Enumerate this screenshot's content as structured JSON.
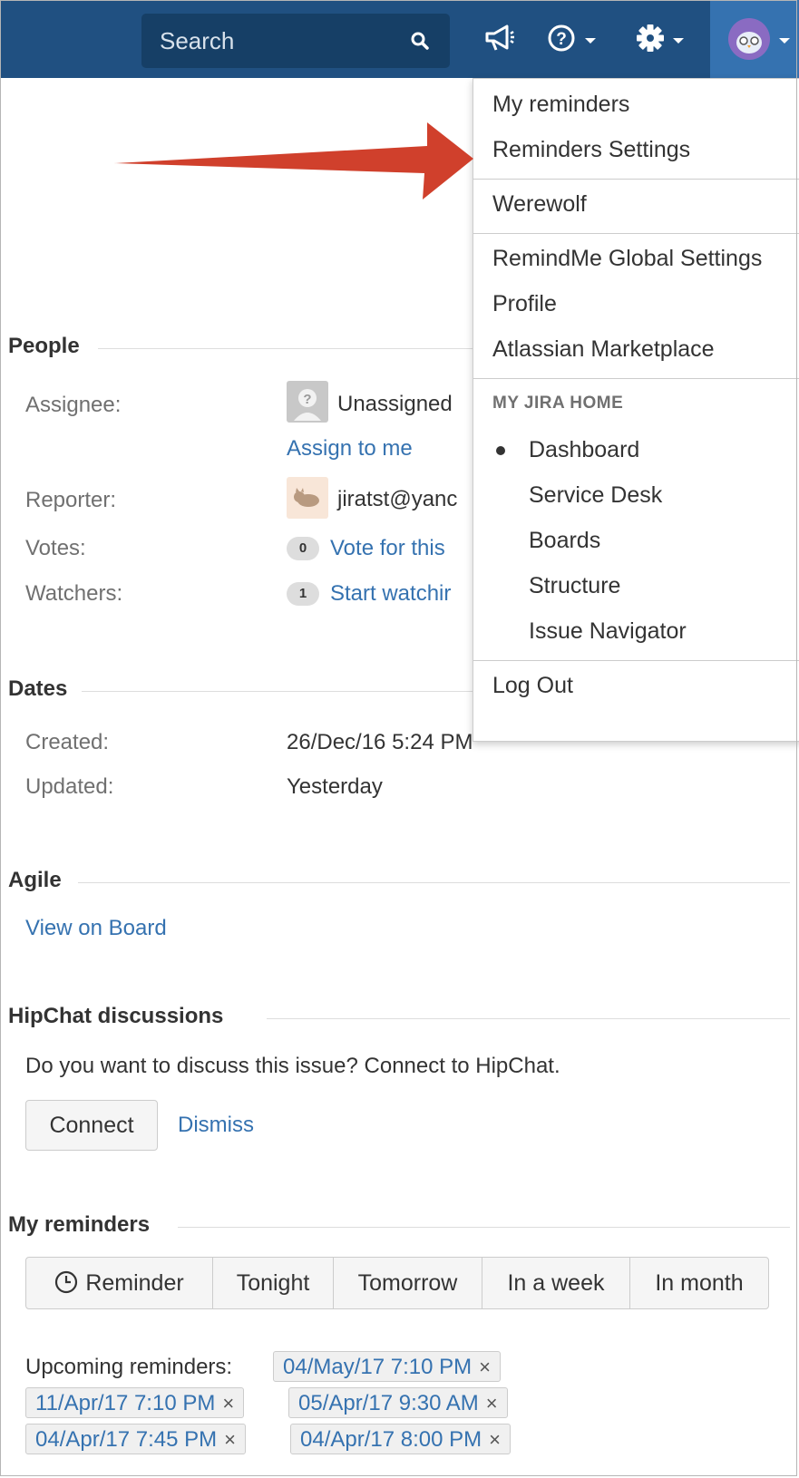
{
  "header": {
    "search_placeholder": "Search",
    "icons": [
      "search-icon",
      "megaphone-icon",
      "help-icon",
      "gear-icon",
      "user-avatar"
    ]
  },
  "menu": {
    "items_top": [
      "My reminders",
      "Reminders Settings"
    ],
    "user_name": "Werewolf",
    "items_mid": [
      "RemindMe Global Settings",
      "Profile",
      "Atlassian Marketplace"
    ],
    "home_heading": "MY JIRA HOME",
    "home_items": [
      "Dashboard",
      "Service Desk",
      "Boards",
      "Structure",
      "Issue Navigator"
    ],
    "selected_home": "Dashboard",
    "logout": "Log Out"
  },
  "people": {
    "title": "People",
    "assignee_label": "Assignee:",
    "assignee_value": "Unassigned",
    "assign_to_me": "Assign to me",
    "reporter_label": "Reporter:",
    "reporter_value": "jiratst@yanc",
    "votes_label": "Votes:",
    "votes_count": "0",
    "votes_link": "Vote for this",
    "watchers_label": "Watchers:",
    "watchers_count": "1",
    "watchers_link": "Start watchir"
  },
  "dates": {
    "title": "Dates",
    "created_label": "Created:",
    "created_value": "26/Dec/16 5:24 PM",
    "updated_label": "Updated:",
    "updated_value": "Yesterday"
  },
  "agile": {
    "title": "Agile",
    "view_on_board": "View on Board"
  },
  "hipchat": {
    "title": "HipChat discussions",
    "prompt": "Do you want to discuss this issue? Connect to HipChat.",
    "connect": "Connect",
    "dismiss": "Dismiss"
  },
  "reminders": {
    "title": "My reminders",
    "buttons": [
      "Reminder",
      "Tonight",
      "Tomorrow",
      "In a week",
      "In month"
    ],
    "upcoming_label": "Upcoming reminders:",
    "upcoming": [
      "04/May/17 7:10 PM",
      "11/Apr/17 7:10 PM",
      "05/Apr/17 9:30 AM",
      "04/Apr/17 7:45 PM",
      "04/Apr/17 8:00 PM"
    ],
    "remove_symbol": "×"
  },
  "colors": {
    "header_bg": "#205081",
    "link": "#3572b0",
    "arrow": "#d0402c"
  }
}
